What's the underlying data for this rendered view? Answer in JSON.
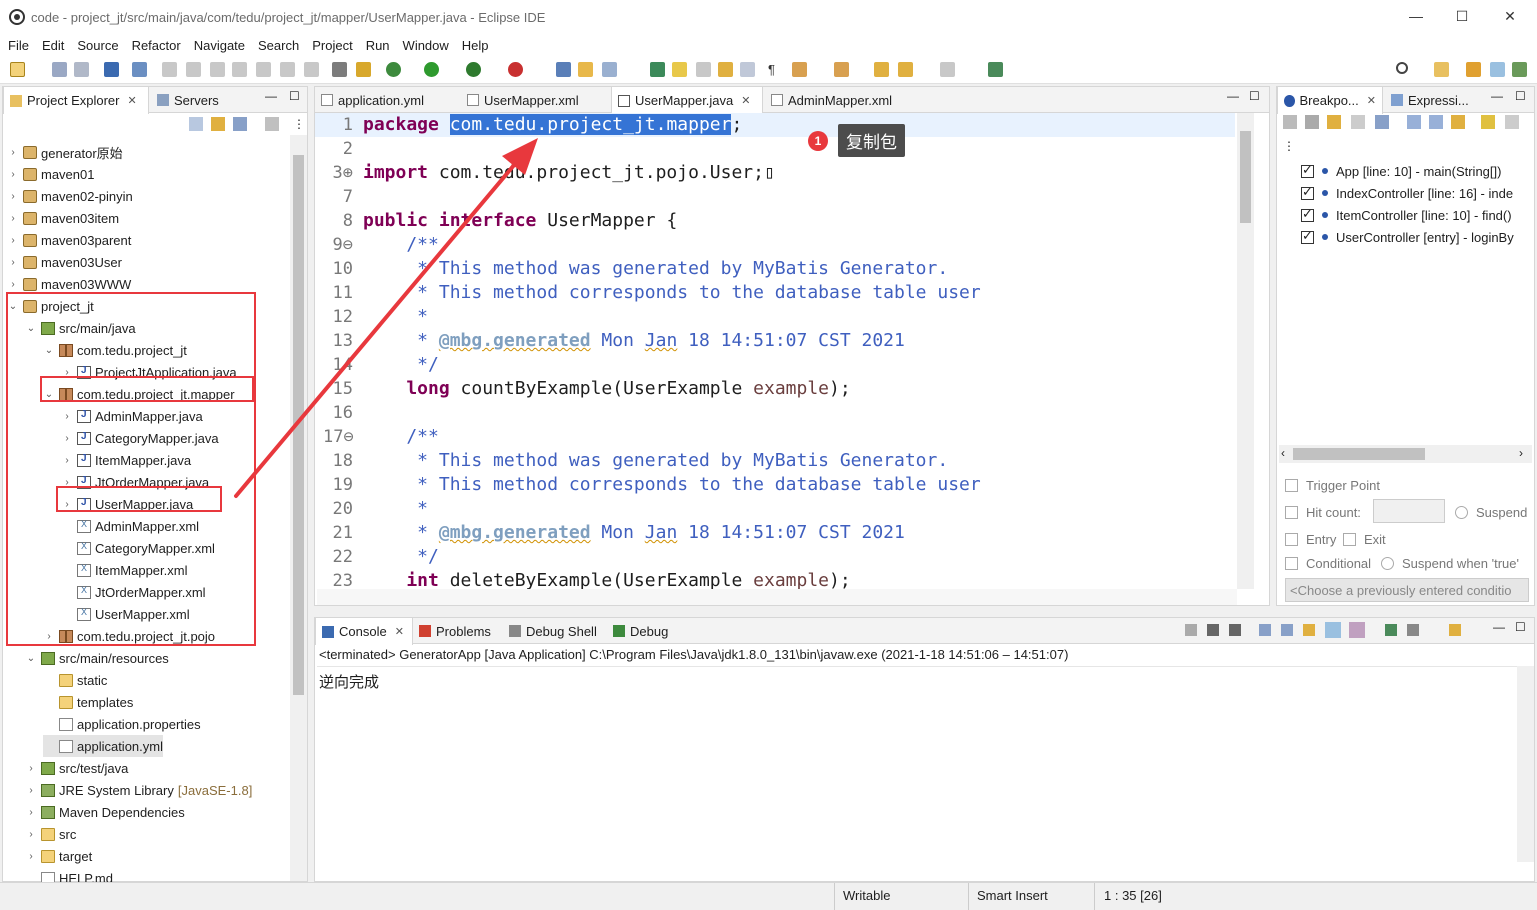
{
  "window": {
    "title": "code - project_jt/src/main/java/com/tedu/project_jt/mapper/UserMapper.java - Eclipse IDE",
    "minimize": "—",
    "maximize": "☐",
    "close": "✕"
  },
  "menu": [
    "File",
    "Edit",
    "Source",
    "Refactor",
    "Navigate",
    "Search",
    "Project",
    "Run",
    "Window",
    "Help"
  ],
  "explorer": {
    "tabs": [
      {
        "label": "Project Explorer",
        "close": "✕"
      },
      {
        "label": "Servers"
      }
    ],
    "items": [
      {
        "label": "generator原始",
        "depth": 0,
        "twisty": "›",
        "icon": "proj"
      },
      {
        "label": "maven01",
        "depth": 0,
        "twisty": "›",
        "icon": "proj"
      },
      {
        "label": "maven02-pinyin",
        "depth": 0,
        "twisty": "›",
        "icon": "proj"
      },
      {
        "label": "maven03item",
        "depth": 0,
        "twisty": "›",
        "icon": "proj"
      },
      {
        "label": "maven03parent",
        "depth": 0,
        "twisty": "›",
        "icon": "proj"
      },
      {
        "label": "maven03User",
        "depth": 0,
        "twisty": "›",
        "icon": "proj"
      },
      {
        "label": "maven03WWW",
        "depth": 0,
        "twisty": "›",
        "icon": "proj"
      },
      {
        "label": "project_jt",
        "depth": 0,
        "twisty": "⌄",
        "icon": "proj"
      },
      {
        "label": "src/main/java",
        "depth": 1,
        "twisty": "⌄",
        "icon": "src"
      },
      {
        "label": "com.tedu.project_jt",
        "depth": 2,
        "twisty": "⌄",
        "icon": "pkg"
      },
      {
        "label": "ProjectJtApplication.java",
        "depth": 3,
        "twisty": "›",
        "icon": "java"
      },
      {
        "label": "com.tedu.project_jt.mapper",
        "depth": 2,
        "twisty": "⌄",
        "icon": "pkg"
      },
      {
        "label": "AdminMapper.java",
        "depth": 3,
        "twisty": "›",
        "icon": "java"
      },
      {
        "label": "CategoryMapper.java",
        "depth": 3,
        "twisty": "›",
        "icon": "java"
      },
      {
        "label": "ItemMapper.java",
        "depth": 3,
        "twisty": "›",
        "icon": "java"
      },
      {
        "label": "JtOrderMapper.java",
        "depth": 3,
        "twisty": "›",
        "icon": "java"
      },
      {
        "label": "UserMapper.java",
        "depth": 3,
        "twisty": "›",
        "icon": "java"
      },
      {
        "label": "AdminMapper.xml",
        "depth": 3,
        "twisty": "",
        "icon": "xml"
      },
      {
        "label": "CategoryMapper.xml",
        "depth": 3,
        "twisty": "",
        "icon": "xml"
      },
      {
        "label": "ItemMapper.xml",
        "depth": 3,
        "twisty": "",
        "icon": "xml"
      },
      {
        "label": "JtOrderMapper.xml",
        "depth": 3,
        "twisty": "",
        "icon": "xml"
      },
      {
        "label": "UserMapper.xml",
        "depth": 3,
        "twisty": "",
        "icon": "xml"
      },
      {
        "label": "com.tedu.project_jt.pojo",
        "depth": 2,
        "twisty": "›",
        "icon": "pkg"
      },
      {
        "label": "src/main/resources",
        "depth": 1,
        "twisty": "⌄",
        "icon": "src"
      },
      {
        "label": "static",
        "depth": 2,
        "twisty": "",
        "icon": "folder"
      },
      {
        "label": "templates",
        "depth": 2,
        "twisty": "",
        "icon": "folder"
      },
      {
        "label": "application.properties",
        "depth": 2,
        "twisty": "",
        "icon": "prop"
      },
      {
        "label": "application.yml",
        "depth": 2,
        "twisty": "",
        "icon": "prop"
      },
      {
        "label": "src/test/java",
        "depth": 1,
        "twisty": "›",
        "icon": "src"
      },
      {
        "label": "JRE System Library",
        "depth": 1,
        "twisty": "›",
        "icon": "lib",
        "suffix": "[JavaSE-1.8]"
      },
      {
        "label": "Maven Dependencies",
        "depth": 1,
        "twisty": "›",
        "icon": "lib"
      },
      {
        "label": "src",
        "depth": 1,
        "twisty": "›",
        "icon": "folder"
      },
      {
        "label": "target",
        "depth": 1,
        "twisty": "›",
        "icon": "folder"
      },
      {
        "label": "HELP.md",
        "depth": 1,
        "twisty": "",
        "icon": "md"
      }
    ]
  },
  "editor": {
    "tabs": [
      {
        "label": "application.yml"
      },
      {
        "label": "UserMapper.xml"
      },
      {
        "label": "UserMapper.java",
        "close": "✕"
      },
      {
        "label": "AdminMapper.xml"
      }
    ],
    "lines": [
      {
        "n": "1",
        "t": [
          [
            "kw",
            "package "
          ],
          [
            "sel",
            "com.tedu.project_jt.mapper"
          ],
          [
            "",
            "; "
          ]
        ]
      },
      {
        "n": "2",
        "t": []
      },
      {
        "n": "3⊕",
        "t": [
          [
            "kw",
            "import "
          ],
          [
            "",
            "com.tedu.project_jt.pojo.User;▯"
          ]
        ]
      },
      {
        "n": "7",
        "t": []
      },
      {
        "n": "8",
        "t": [
          [
            "kw",
            "public interface "
          ],
          [
            "",
            "UserMapper {"
          ]
        ]
      },
      {
        "n": "9⊖",
        "t": [
          [
            "cm",
            "    /**"
          ]
        ]
      },
      {
        "n": "10",
        "t": [
          [
            "cm",
            "     * This method was generated by MyBatis Generator."
          ]
        ]
      },
      {
        "n": "11",
        "t": [
          [
            "cm",
            "     * This method corresponds to the database table user"
          ]
        ]
      },
      {
        "n": "12",
        "t": [
          [
            "cm",
            "     *"
          ]
        ]
      },
      {
        "n": "13",
        "t": [
          [
            "cm",
            "     * "
          ],
          [
            "tag",
            "@mbg.generated"
          ],
          [
            "cm",
            " Mon "
          ],
          [
            "cmu",
            "Jan"
          ],
          [
            "cm",
            " 18 14:51:07 CST 2021"
          ]
        ]
      },
      {
        "n": "14",
        "t": [
          [
            "cm",
            "     */"
          ]
        ]
      },
      {
        "n": "15",
        "t": [
          [
            "kw",
            "    long "
          ],
          [
            "",
            "countByExample(UserExample "
          ],
          [
            "var",
            "example"
          ],
          [
            "",
            ");"
          ]
        ]
      },
      {
        "n": "16",
        "t": []
      },
      {
        "n": "17⊖",
        "t": [
          [
            "cm",
            "    /**"
          ]
        ]
      },
      {
        "n": "18",
        "t": [
          [
            "cm",
            "     * This method was generated by MyBatis Generator."
          ]
        ]
      },
      {
        "n": "19",
        "t": [
          [
            "cm",
            "     * This method corresponds to the database table user"
          ]
        ]
      },
      {
        "n": "20",
        "t": [
          [
            "cm",
            "     *"
          ]
        ]
      },
      {
        "n": "21",
        "t": [
          [
            "cm",
            "     * "
          ],
          [
            "tag",
            "@mbg.generated"
          ],
          [
            "cm",
            " Mon "
          ],
          [
            "cmu",
            "Jan"
          ],
          [
            "cm",
            " 18 14:51:07 CST 2021"
          ]
        ]
      },
      {
        "n": "22",
        "t": [
          [
            "cm",
            "     */"
          ]
        ]
      },
      {
        "n": "23",
        "t": [
          [
            "kw",
            "    int "
          ],
          [
            "",
            "deleteByExample(UserExample "
          ],
          [
            "var",
            "example"
          ],
          [
            "",
            ");"
          ]
        ]
      }
    ]
  },
  "callout": {
    "number": "1",
    "label": "复制包"
  },
  "breakpoints": {
    "tabs": [
      {
        "label": "Breakpo...",
        "close": "✕"
      },
      {
        "label": "Expressi..."
      }
    ],
    "items": [
      {
        "label": "App [line: 10] - main(String[])"
      },
      {
        "label": "IndexController [line: 16] - inde"
      },
      {
        "label": "ItemController [line: 10] - find()"
      },
      {
        "label": "UserController [entry] - loginBy"
      }
    ],
    "trigger_point": "Trigger Point",
    "hit_count": "Hit count:",
    "suspend": "Suspend",
    "entry": "Entry",
    "exit": "Exit",
    "conditional": "Conditional",
    "suspend_when": "Suspend when 'true'",
    "condition_placeholder": "<Choose a previously entered conditio"
  },
  "console": {
    "tabs": [
      {
        "label": "Console",
        "close": "✕"
      },
      {
        "label": "Problems"
      },
      {
        "label": "Debug Shell"
      },
      {
        "label": "Debug"
      }
    ],
    "header": "<terminated> GeneratorApp [Java Application] C:\\Program Files\\Java\\jdk1.8.0_131\\bin\\javaw.exe  (2021-1-18 14:51:06 – 14:51:07)",
    "output": "逆向完成"
  },
  "status": {
    "writable": "Writable",
    "insert": "Smart Insert",
    "position": "1 : 35 [26]"
  },
  "colors": {
    "accent": "#3574d5",
    "annotation_red": "#e8383d",
    "keyword": "#7f0055",
    "comment": "#3f5fbf"
  }
}
